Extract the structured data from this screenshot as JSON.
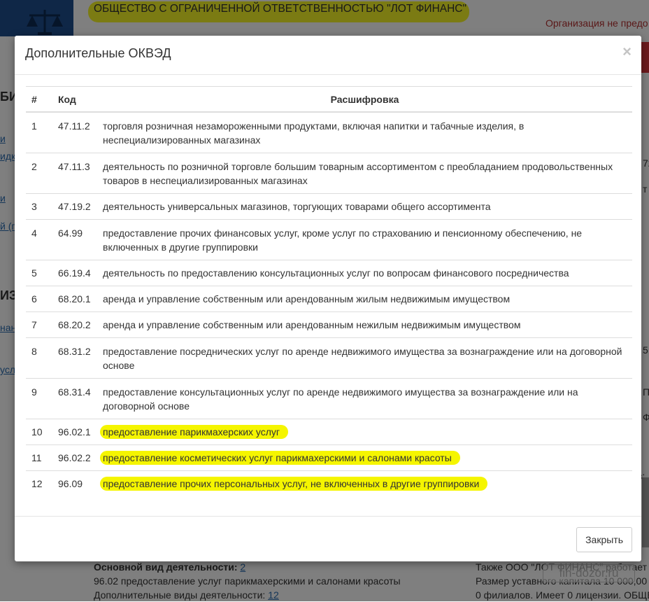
{
  "background": {
    "org_name": "ОБЩЕСТВО С ОГРАНИЧЕННОЙ ОТВЕТСТВЕННОСТЬЮ \"ЛОТ ФИНАНС\"",
    "org_note": "Организация не предо",
    "left_fragments": [
      "БИ",
      "и",
      "идк",
      "и",
      "й (п",
      "ИЗ",
      "нан",
      "усл"
    ],
    "right_fragments": [
      "72",
      "т",
      "5",
      "Пр",
      "Ф",
      "з:"
    ],
    "main_activity_label": "Основной вид деятельности:",
    "main_activity_count": "2",
    "main_activity_value": "96.02 предоставление услуг парикмахерскими и салонами красоты",
    "additional_activities_label": "Дополнительные виды деятельности:",
    "additional_activities_count": "12",
    "right_footer": [
      "Также ООО \"ЛОТ ФИНАНС\" работает",
      "Размер уставного капитала 10 000,00",
      "0 филиалов. Имеет 0 лицензии. ОБЩЕ"
    ],
    "watermark": "fin-dozor.ru"
  },
  "modal": {
    "title": "Дополнительные ОКВЭД",
    "close_glyph": "×",
    "columns": {
      "num": "#",
      "code": "Код",
      "desc": "Расшифровка"
    },
    "rows": [
      {
        "num": "1",
        "code": "47.11.2",
        "desc": "торговля розничная незамороженными продуктами, включая напитки и табачные изделия, в неспециализированных магазинах",
        "highlight": false
      },
      {
        "num": "2",
        "code": "47.11.3",
        "desc": "деятельность по розничной торговле большим товарным ассортиментом с преобладанием продовольственных товаров в неспециализированных магазинах",
        "highlight": false
      },
      {
        "num": "3",
        "code": "47.19.2",
        "desc": "деятельность универсальных магазинов, торгующих товарами общего ассортимента",
        "highlight": false
      },
      {
        "num": "4",
        "code": "64.99",
        "desc": "предоставление прочих финансовых услуг, кроме услуг по страхованию и пенсионному обеспечению, не включенных в другие группировки",
        "highlight": false
      },
      {
        "num": "5",
        "code": "66.19.4",
        "desc": "деятельность по предоставлению консультационных услуг по вопросам финансового посредничества",
        "highlight": false
      },
      {
        "num": "6",
        "code": "68.20.1",
        "desc": "аренда и управление собственным или арендованным жилым недвижимым имуществом",
        "highlight": false
      },
      {
        "num": "7",
        "code": "68.20.2",
        "desc": "аренда и управление собственным или арендованным нежилым недвижимым имуществом",
        "highlight": false
      },
      {
        "num": "8",
        "code": "68.31.2",
        "desc": "предоставление посреднических услуг по аренде недвижимого имущества за вознаграждение или на договорной основе",
        "highlight": false
      },
      {
        "num": "9",
        "code": "68.31.4",
        "desc": "предоставление консультационных услуг по аренде недвижимого имущества за вознаграждение или на договорной основе",
        "highlight": false
      },
      {
        "num": "10",
        "code": "96.02.1",
        "desc": "предоставление парикмахерских услуг",
        "highlight": true
      },
      {
        "num": "11",
        "code": "96.02.2",
        "desc": "предоставление косметических услуг парикмахерскими и салонами красоты",
        "highlight": true
      },
      {
        "num": "12",
        "code": "96.09",
        "desc": "предоставление прочих персональных услуг, не включенных в другие группировки",
        "highlight": true
      }
    ],
    "close_button": "Закрыть"
  },
  "colors": {
    "highlight": "#f5f500",
    "link": "#2a6cb0",
    "logo_bg": "#1f4f8f",
    "alert_red": "#d9343a"
  }
}
